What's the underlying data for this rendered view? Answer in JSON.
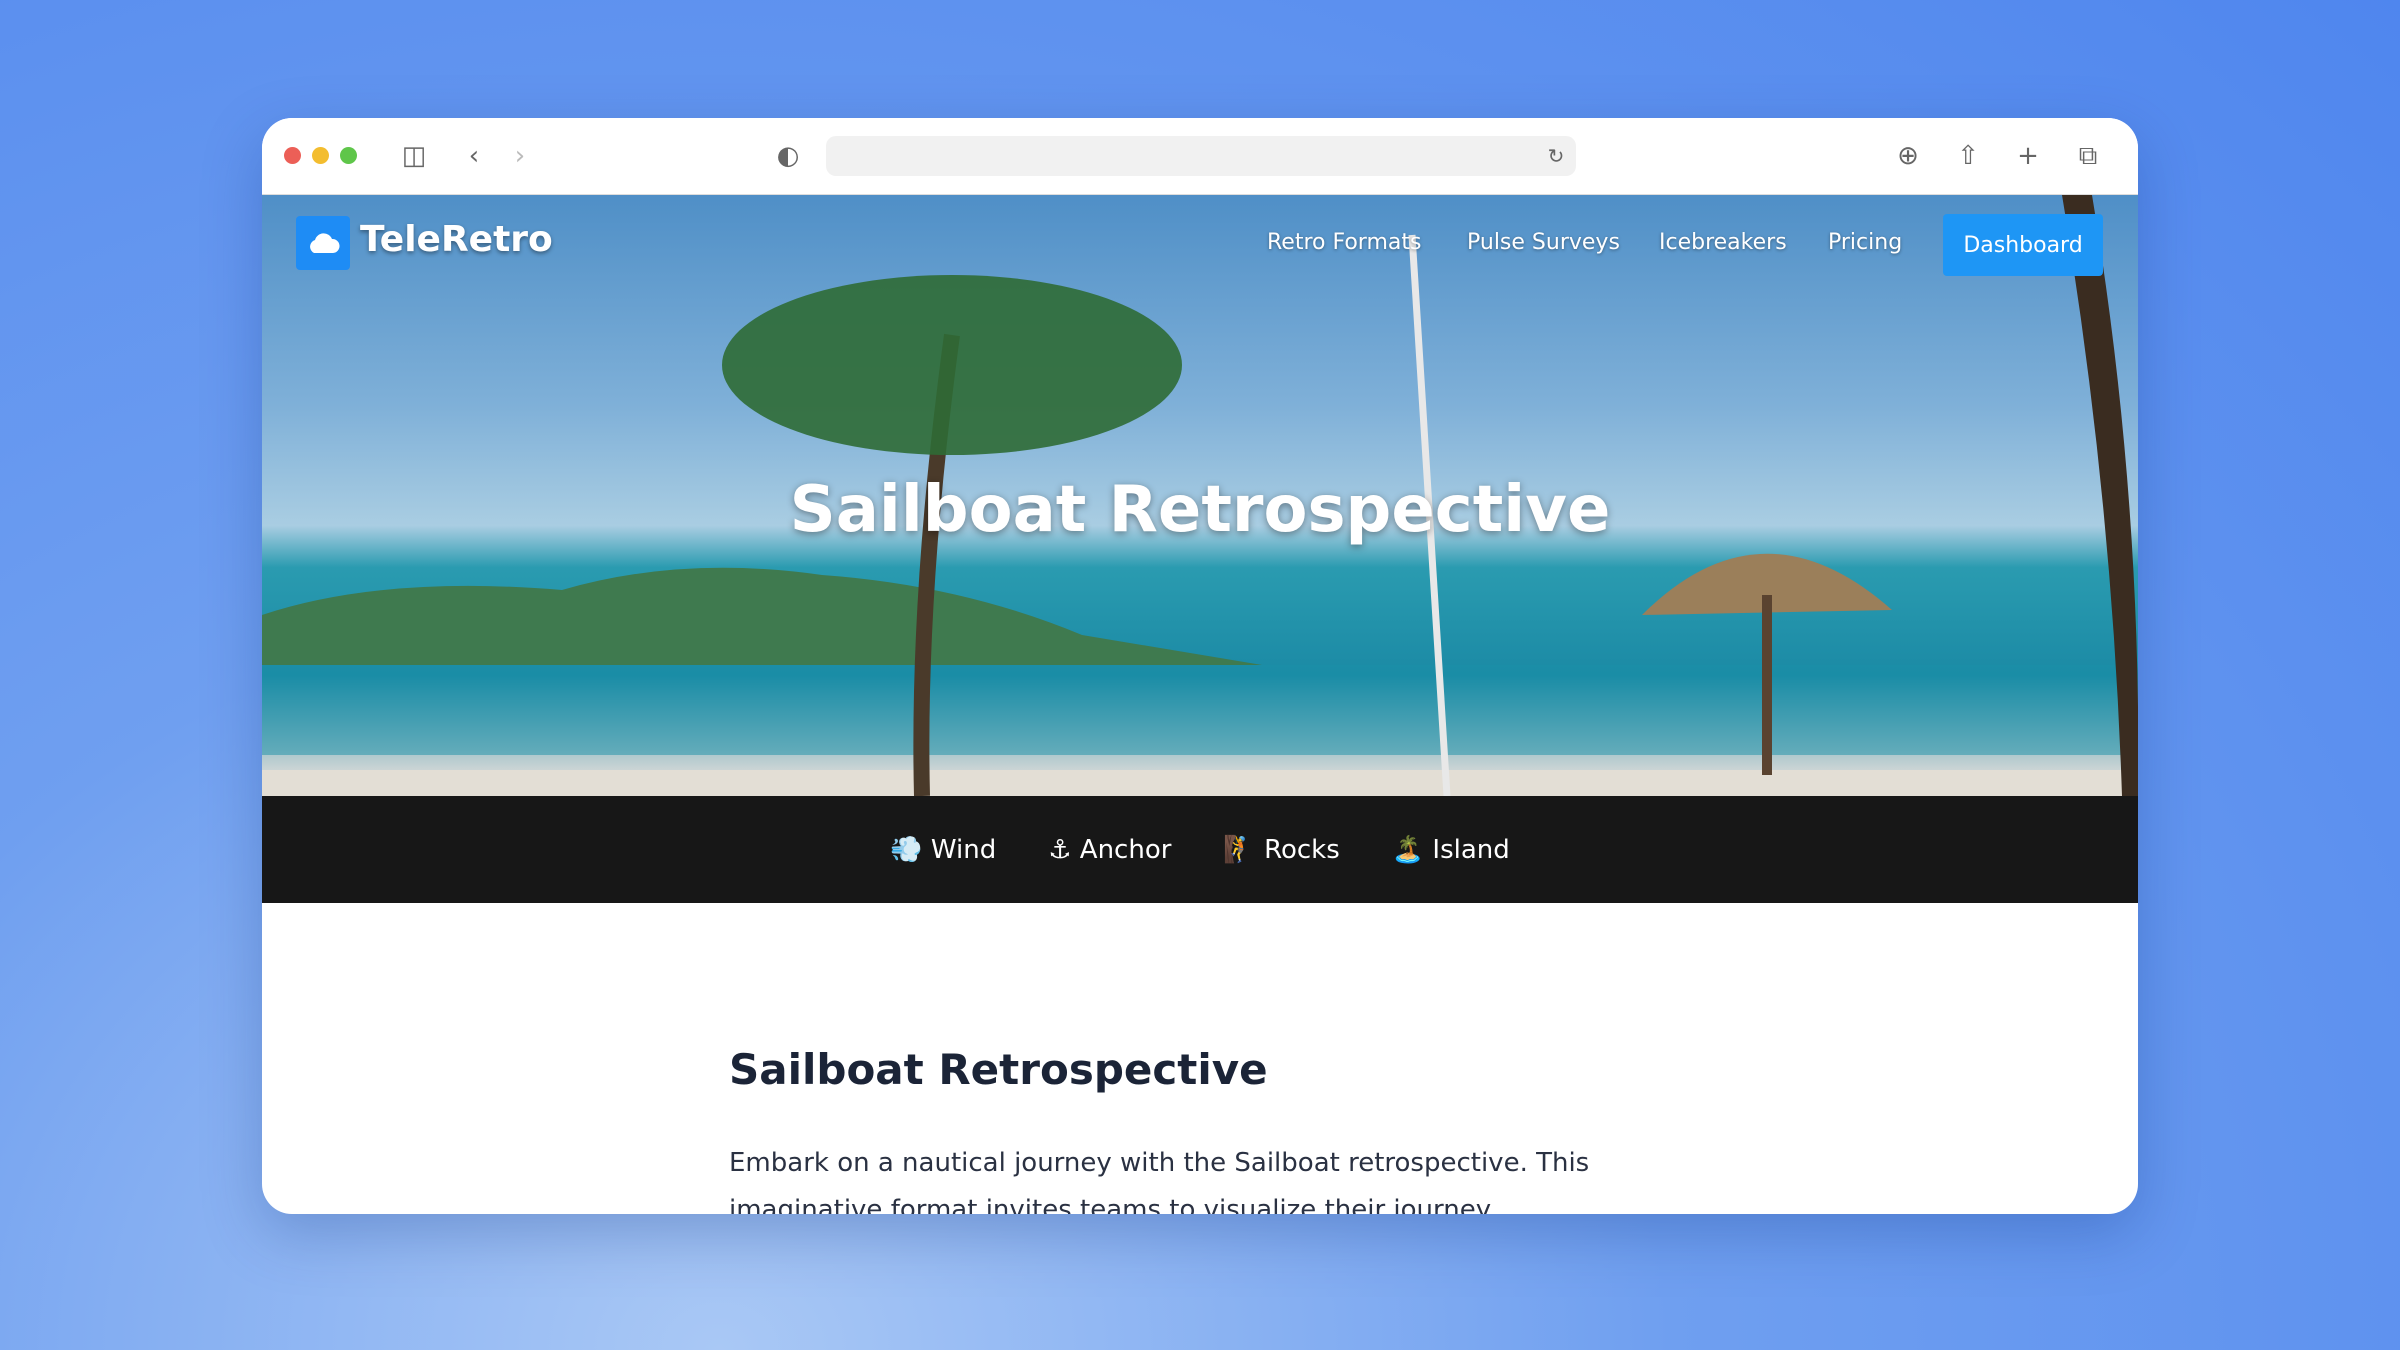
{
  "browser": {
    "url": "",
    "icons": [
      "sidebar-icon",
      "back-icon",
      "forward-icon",
      "shield-icon",
      "reload-icon",
      "download-icon",
      "share-icon",
      "new-tab-icon",
      "tabs-icon"
    ]
  },
  "nav": {
    "brand": "TeleRetro",
    "links": [
      "Retro Formats",
      "Pulse Surveys",
      "Icebreakers",
      "Pricing"
    ],
    "cta": "Dashboard",
    "accent": "#1e96f5"
  },
  "hero": {
    "title": "Sailboat Retrospective"
  },
  "band": {
    "items": [
      {
        "emoji": "💨",
        "label": "Wind"
      },
      {
        "emoji": "⚓",
        "label": "Anchor"
      },
      {
        "emoji": "🧗",
        "label": "Rocks"
      },
      {
        "emoji": "🏝️",
        "label": "Island"
      }
    ]
  },
  "content": {
    "heading": "Sailboat Retrospective",
    "paragraph": "Embark on a nautical journey with the Sailboat retrospective. This imaginative format invites teams to visualize their journey, challenges"
  }
}
